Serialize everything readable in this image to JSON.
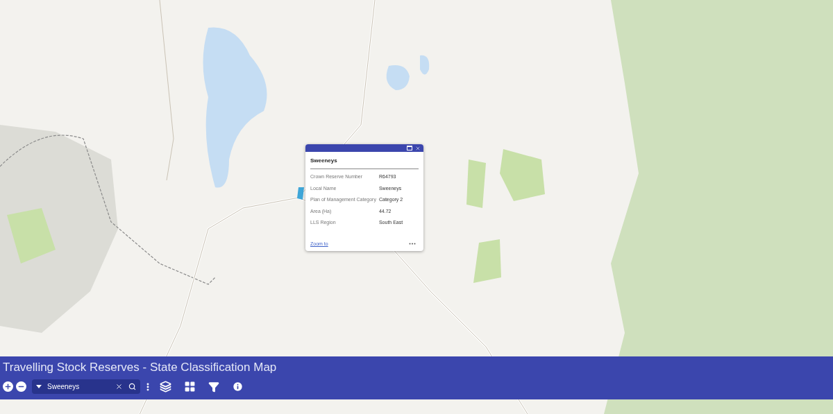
{
  "popup": {
    "title": "Sweeneys",
    "fields": [
      {
        "label": "Crown Reserve Number",
        "value": "R64793"
      },
      {
        "label": "Local Name",
        "value": "Sweeneys"
      },
      {
        "label": "Plan of Management Category",
        "value": "Category 2"
      },
      {
        "label": "Area (Ha)",
        "value": "44.72"
      },
      {
        "label": "LLS Region",
        "value": "South East"
      }
    ],
    "action": "Zoom to"
  },
  "app_bar": {
    "title": "Travelling Stock Reserves - State Classification Map",
    "search": {
      "value": "Sweeneys"
    }
  }
}
